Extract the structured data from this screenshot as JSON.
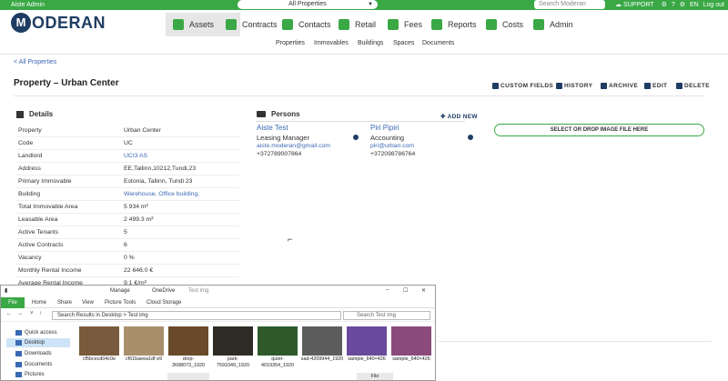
{
  "topbar": {
    "user": "Aiste Admin",
    "property_select": "All Properties",
    "search_placeholder": "Search Moderan",
    "support": "SUPPORT",
    "language": "EN",
    "logout": "Log out"
  },
  "logo": {
    "mark": "M",
    "word": "ODERAN"
  },
  "nav": [
    {
      "label": "Assets"
    },
    {
      "label": "Contracts"
    },
    {
      "label": "Contacts"
    },
    {
      "label": "Retail"
    },
    {
      "label": "Fees"
    },
    {
      "label": "Reports"
    },
    {
      "label": "Costs"
    },
    {
      "label": "Admin"
    }
  ],
  "subnav": [
    "Properties",
    "Immovables",
    "Buildings",
    "Spaces",
    "Documents"
  ],
  "breadcrumb": "< All Properties",
  "page_title": "Property – Urban Center",
  "actions": [
    "CUSTOM FIELDS",
    "HISTORY",
    "ARCHIVE",
    "EDIT",
    "DELETE"
  ],
  "details": {
    "heading": "Details",
    "rows": [
      {
        "key": "Property",
        "value": "Urban Center"
      },
      {
        "key": "Code",
        "value": "UC"
      },
      {
        "key": "Landlord",
        "value": "UCI3 AS"
      },
      {
        "key": "Address",
        "value": "EE,Tallinn,10212,Tundi,23"
      },
      {
        "key": "Primary Immovable",
        "value": "Estonia, Tallinn, Tundi 23"
      },
      {
        "key": "Building",
        "value": "Warehouse, Office building,"
      },
      {
        "key": "Total Immovable Area",
        "value": "5 934 m²"
      },
      {
        "key": "Leasable Area",
        "value": "2 499.3 m²"
      },
      {
        "key": "Active Tenants",
        "value": "5"
      },
      {
        "key": "Active Contracts",
        "value": "6"
      },
      {
        "key": "Vacancy",
        "value": "0 %"
      },
      {
        "key": "Monthly Rental Income",
        "value": "22 646.0 €"
      },
      {
        "key": "Average Rental Income",
        "value": "9.1 €/m²"
      }
    ]
  },
  "persons": {
    "heading": "Persons",
    "add_new": "ADD NEW",
    "list": [
      {
        "name": "Aiste Test",
        "role": "Leasing Manager",
        "email": "aiste.moderan@gmail.com",
        "phone": "+372789007864"
      },
      {
        "name": "Piri Pipiri",
        "role": "Accounting",
        "email": "piri@urban.com",
        "phone": "+372098786764"
      }
    ]
  },
  "image_button": "SELECT OR DROP IMAGE FILE HERE",
  "explorer": {
    "title": "Test img",
    "tabs_top": [
      "Manage",
      "OneDrive"
    ],
    "ribbon": [
      "File",
      "Home",
      "Share",
      "View",
      "Picture Tools",
      "Cloud Storage"
    ],
    "path": "Search Results in Desktop  >  Test img",
    "search_placeholder": "Search Test img",
    "sidebar": [
      "Quick access",
      "Desktop",
      "Downloads",
      "Documents",
      "Pictures"
    ],
    "files": [
      {
        "name": "cf5bcecd04c0e",
        "color": "#7a5a3c"
      },
      {
        "name": "cf61baeea1df e9",
        "color": "#a88f6c"
      },
      {
        "name": "drop-3698073_1920",
        "color": "#6a4a2a"
      },
      {
        "name": "park-7591049_1920",
        "color": "#2e2c24"
      },
      {
        "name": "quiet-4019354_1920",
        "color": "#2e5a2a"
      },
      {
        "name": "sad-4209944_1920",
        "color": "#5d5d5d"
      },
      {
        "name": "sample_640×426",
        "color": "#6a4a9c"
      },
      {
        "name": "sample_640×426",
        "color": "#8a4a7c"
      }
    ],
    "status_file": "File"
  }
}
